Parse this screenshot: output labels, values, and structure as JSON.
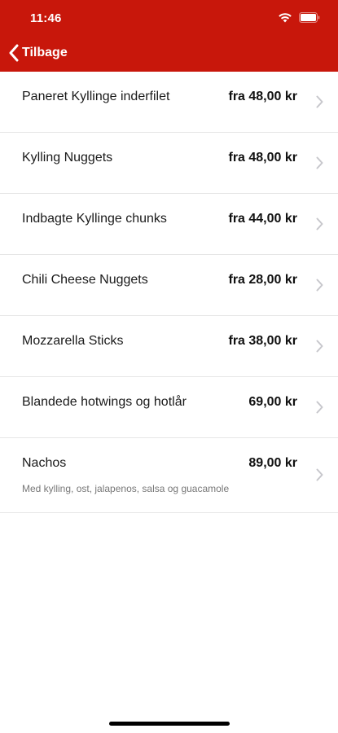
{
  "status_bar": {
    "time": "11:46"
  },
  "nav": {
    "back_label": "Tilbage"
  },
  "items": [
    {
      "name": "Paneret Kyllinge inderfilet",
      "price": "fra 48,00 kr",
      "description": ""
    },
    {
      "name": "Kylling Nuggets",
      "price": "fra 48,00 kr",
      "description": ""
    },
    {
      "name": "Indbagte Kyllinge chunks",
      "price": "fra 44,00 kr",
      "description": ""
    },
    {
      "name": "Chili Cheese Nuggets",
      "price": "fra 28,00 kr",
      "description": ""
    },
    {
      "name": "Mozzarella Sticks",
      "price": "fra 38,00 kr",
      "description": ""
    },
    {
      "name": "Blandede hotwings og hotlår",
      "price": "69,00 kr",
      "description": ""
    },
    {
      "name": "Nachos",
      "price": "89,00 kr",
      "description": "Med kylling, ost, jalapenos, salsa og guacamole"
    }
  ],
  "colors": {
    "header_bg": "#c8170b",
    "chevron": "#c7c7cc"
  }
}
